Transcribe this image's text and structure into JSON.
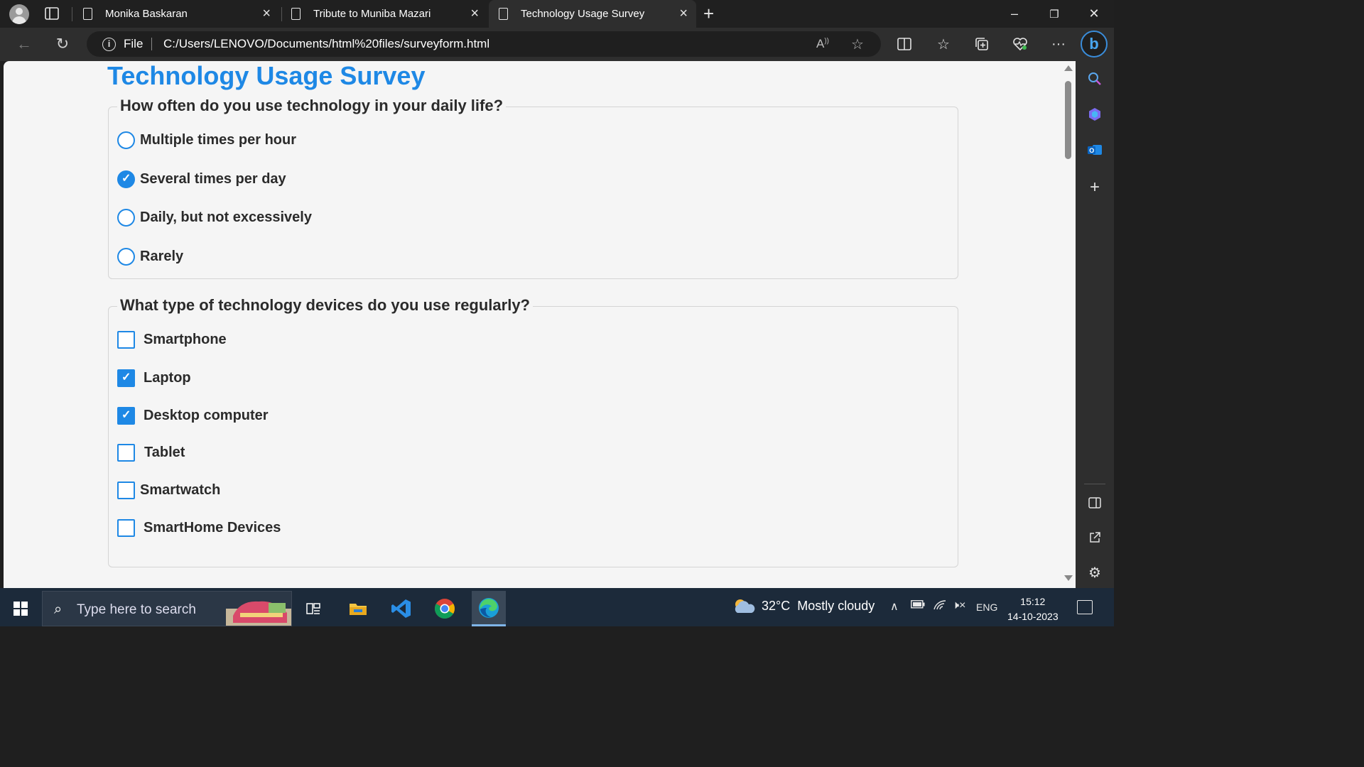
{
  "browser": {
    "tabs": [
      {
        "title": "Monika Baskaran",
        "active": false
      },
      {
        "title": "Tribute to Muniba Mazari",
        "active": false
      },
      {
        "title": "Technology Usage Survey",
        "active": true
      }
    ],
    "address": {
      "scheme_label": "File",
      "url": "C:/Users/LENOVO/Documents/html%20files/surveyform.html"
    },
    "icons": {
      "back": "back-arrow-icon",
      "reload": "reload-icon",
      "info": "info-icon",
      "read_aloud": "read-aloud-icon",
      "favorite": "star-icon",
      "split": "split-screen-icon",
      "favorites": "favorites-icon",
      "collections": "collections-icon",
      "health": "browser-essentials-icon",
      "more": "more-icon",
      "copilot": "copilot-icon"
    },
    "window_controls": {
      "minimize": "–",
      "restore": "❐",
      "close": "✕"
    }
  },
  "page": {
    "title": "Technology Usage Survey",
    "questions": [
      {
        "legend": "How often do you use technology in your daily life?",
        "type": "radio",
        "options": [
          {
            "label": "Multiple times per hour",
            "checked": false
          },
          {
            "label": "Several times per day",
            "checked": true
          },
          {
            "label": "Daily, but not excessively",
            "checked": false
          },
          {
            "label": "Rarely",
            "checked": false
          }
        ]
      },
      {
        "legend": "What type of technology devices do you use regularly?",
        "type": "checkbox",
        "options": [
          {
            "label": "Smartphone",
            "checked": false
          },
          {
            "label": "Laptop",
            "checked": true
          },
          {
            "label": "Desktop computer",
            "checked": true
          },
          {
            "label": "Tablet",
            "checked": false
          },
          {
            "label": "Smartwatch",
            "checked": false
          },
          {
            "label": "SmartHome Devices",
            "checked": false
          }
        ]
      }
    ]
  },
  "sidepanel": {
    "icons": [
      "search-icon",
      "copilot-app-icon",
      "outlook-icon",
      "add-icon",
      "hide-sidebar-icon",
      "open-external-icon",
      "settings-icon"
    ]
  },
  "taskbar": {
    "search_placeholder": "Type here to search",
    "apps": [
      "task-view",
      "file-explorer",
      "vs-code",
      "chrome",
      "edge"
    ],
    "weather": {
      "temp": "32°C",
      "condition": "Mostly cloudy"
    },
    "language": "ENG",
    "time": "15:12",
    "date": "14-10-2023"
  },
  "colors": {
    "accent": "#1e88e5",
    "page_bg": "#f5f5f5",
    "chrome_dark": "#202020",
    "taskbar": "#1c2a3a"
  }
}
